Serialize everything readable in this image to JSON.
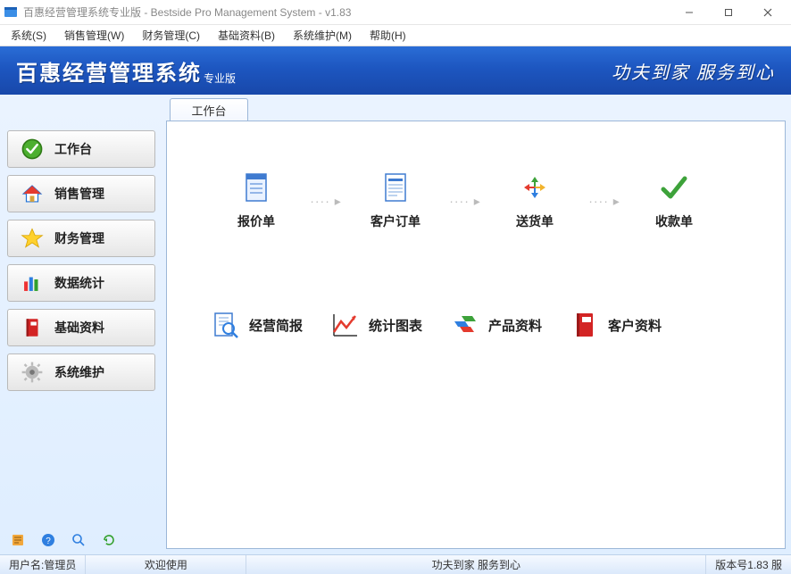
{
  "window": {
    "title": "百惠经营管理系统专业版 - Bestside Pro Management System - v1.83"
  },
  "menu": {
    "items": [
      "系统(S)",
      "销售管理(W)",
      "财务管理(C)",
      "基础资料(B)",
      "系统维护(M)",
      "帮助(H)"
    ]
  },
  "banner": {
    "brand_main": "百惠经营管理系统",
    "brand_sub": "专业版",
    "slogan": "功夫到家 服务到心"
  },
  "sidebar": {
    "items": [
      {
        "label": "工作台",
        "icon": "check-circle-icon"
      },
      {
        "label": "销售管理",
        "icon": "house-icon"
      },
      {
        "label": "财务管理",
        "icon": "star-icon"
      },
      {
        "label": "数据统计",
        "icon": "bar-chart-icon"
      },
      {
        "label": "基础资料",
        "icon": "book-icon"
      },
      {
        "label": "系统维护",
        "icon": "gear-icon"
      }
    ],
    "bottom_icons": [
      "note-icon",
      "help-icon",
      "search-icon",
      "refresh-icon"
    ]
  },
  "tabs": {
    "active": "工作台"
  },
  "workspace": {
    "flow": [
      {
        "label": "报价单",
        "icon": "quote-doc-icon"
      },
      {
        "label": "客户订单",
        "icon": "order-doc-icon"
      },
      {
        "label": "送货单",
        "icon": "delivery-icon"
      },
      {
        "label": "收款单",
        "icon": "receive-check-icon"
      }
    ],
    "shortcuts": [
      {
        "label": "经营简报",
        "icon": "report-magnifier-icon"
      },
      {
        "label": "统计图表",
        "icon": "trend-line-icon"
      },
      {
        "label": "产品资料",
        "icon": "product-stack-icon"
      },
      {
        "label": "客户资料",
        "icon": "customer-book-icon"
      }
    ]
  },
  "status": {
    "user_prefix": "用户名:",
    "user": "管理员",
    "welcome": "欢迎使用",
    "slogan": "功夫到家 服务到心",
    "version_label": "版本号1.83  服"
  }
}
